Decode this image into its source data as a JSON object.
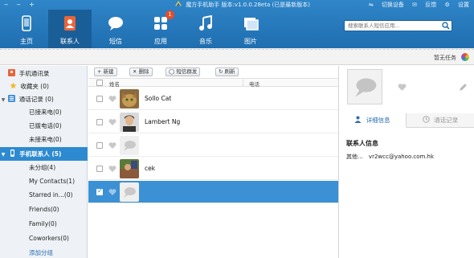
{
  "window": {
    "controls": "‒ ‒ +",
    "title": "魔方手机助手  版本:v1.0.0.28eta (已是最新版本)",
    "top_right": {
      "switch_device": "切换设备",
      "feedback": "反馈",
      "settings": "设置"
    }
  },
  "nav": {
    "items": [
      {
        "label": "主页",
        "icon": "phone-icon"
      },
      {
        "label": "联系人",
        "icon": "contacts-icon",
        "active": true
      },
      {
        "label": "短信",
        "icon": "chat-icon"
      },
      {
        "label": "应用",
        "icon": "apps-icon",
        "badge": "1"
      },
      {
        "label": "音乐",
        "icon": "music-icon"
      },
      {
        "label": "图片",
        "icon": "pictures-icon"
      }
    ],
    "search_placeholder": "搜索联系人短信应用..."
  },
  "subbar": {
    "tasks": "暂无任务"
  },
  "sidebar": {
    "items": [
      {
        "label": "手机通讯录",
        "kind": "root",
        "icon": "address-book-icon"
      },
      {
        "label": "收藏夹 (0)",
        "kind": "item",
        "icon": "star-icon"
      },
      {
        "label": "通话记录 (0)",
        "kind": "group",
        "icon": "call-log-icon"
      },
      {
        "label": "已接来电(0)",
        "kind": "sub"
      },
      {
        "label": "已拨电话(0)",
        "kind": "sub"
      },
      {
        "label": "未接来电(0)",
        "kind": "sub"
      },
      {
        "label": "手机联系人 (5)",
        "kind": "group-selected",
        "icon": "phone-contacts-icon"
      },
      {
        "label": "未分组(4)",
        "kind": "sub"
      },
      {
        "label": "My Contacts(1)",
        "kind": "sub"
      },
      {
        "label": "Starred in...(0)",
        "kind": "sub"
      },
      {
        "label": "Friends(0)",
        "kind": "sub"
      },
      {
        "label": "Family(0)",
        "kind": "sub"
      },
      {
        "label": "Coworkers(0)",
        "kind": "sub"
      },
      {
        "label": "添加分组",
        "kind": "link"
      }
    ]
  },
  "toolbar": {
    "new": "+ 新建",
    "delete": "✕ 删除",
    "sms_group": "短信群发",
    "refresh": "刷新"
  },
  "list": {
    "header": {
      "name": "姓名",
      "phone": "电话"
    },
    "rows": [
      {
        "name": "Sollo Cat",
        "avatar": "cat-photo",
        "checked": false,
        "selected": false
      },
      {
        "name": "Lambert Ng",
        "avatar": "person-photo",
        "checked": false,
        "selected": false
      },
      {
        "name": "",
        "avatar": "default-avatar",
        "checked": false,
        "selected": false
      },
      {
        "name": "cek",
        "avatar": "photo",
        "checked": false,
        "selected": false
      },
      {
        "name": "",
        "avatar": "default-avatar",
        "checked": true,
        "selected": true
      }
    ]
  },
  "detail": {
    "tabs": [
      {
        "label": "详细信息",
        "active": true,
        "icon": "person-icon"
      },
      {
        "label": "通话记录",
        "active": false,
        "icon": "clock-icon"
      }
    ],
    "section_title": "联系人信息",
    "other_label": "其他...",
    "email": "vr2wcc@yahoo.com.hk"
  },
  "colors": {
    "accent": "#2d8ad0",
    "topbar": "#2579bd",
    "badge": "#e84b2a"
  }
}
